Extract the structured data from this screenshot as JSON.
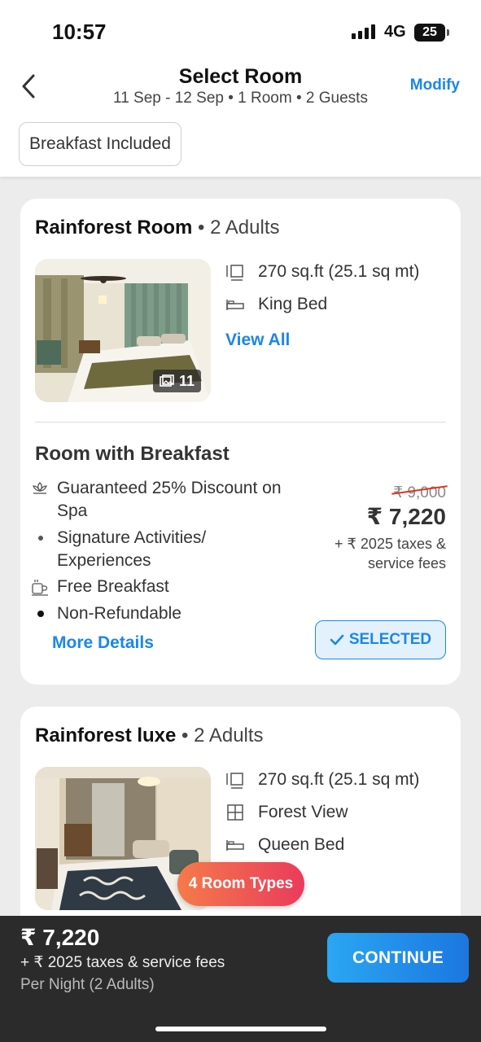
{
  "status": {
    "time": "10:57",
    "network": "4G",
    "battery": "25"
  },
  "header": {
    "title": "Select Room",
    "subtitle": "11 Sep - 12 Sep • 1 Room • 2 Guests",
    "modify_label": "Modify",
    "filter_chip": "Breakfast Included"
  },
  "rooms": [
    {
      "name": "Rainforest Room",
      "occupancy": "2 Adults",
      "photo_count": "11",
      "features": [
        {
          "icon": "area-icon",
          "label": "270 sq.ft (25.1 sq mt)"
        },
        {
          "icon": "bed-icon",
          "label": "King Bed"
        }
      ],
      "view_all_label": "View All",
      "plan": {
        "title": "Room with Breakfast",
        "inclusions": [
          {
            "icon": "spa-icon",
            "text": "Guaranteed 25% Discount on Spa"
          },
          {
            "icon": "bullet",
            "text": "Signature Activities/ Experiences"
          },
          {
            "icon": "breakfast-icon",
            "text": "Free Breakfast"
          },
          {
            "icon": "bullet",
            "text": "Non-Refundable"
          }
        ],
        "more_details_label": "More Details",
        "original_price": "₹ 9,000",
        "price": "₹ 7,220",
        "taxes": "+ ₹ 2025 taxes & service fees",
        "selected_label": "SELECTED"
      }
    },
    {
      "name": "Rainforest luxe",
      "occupancy": "2 Adults",
      "features": [
        {
          "icon": "area-icon",
          "label": "270 sq.ft (25.1 sq mt)"
        },
        {
          "icon": "window-icon",
          "label": "Forest View"
        },
        {
          "icon": "bed-icon",
          "label": "Queen Bed"
        }
      ]
    }
  ],
  "room_types_label": "4 Room Types",
  "footer": {
    "total_price": "₹ 7,220",
    "taxes": "+ ₹ 2025 taxes & service fees",
    "per_night": "Per Night (2 Adults)",
    "continue_label": "CONTINUE"
  },
  "colors": {
    "accent": "#1a87e8",
    "selected_bg": "#e3f1fc",
    "footer_bg": "#2b2b2b",
    "strike": "#e0301e"
  }
}
